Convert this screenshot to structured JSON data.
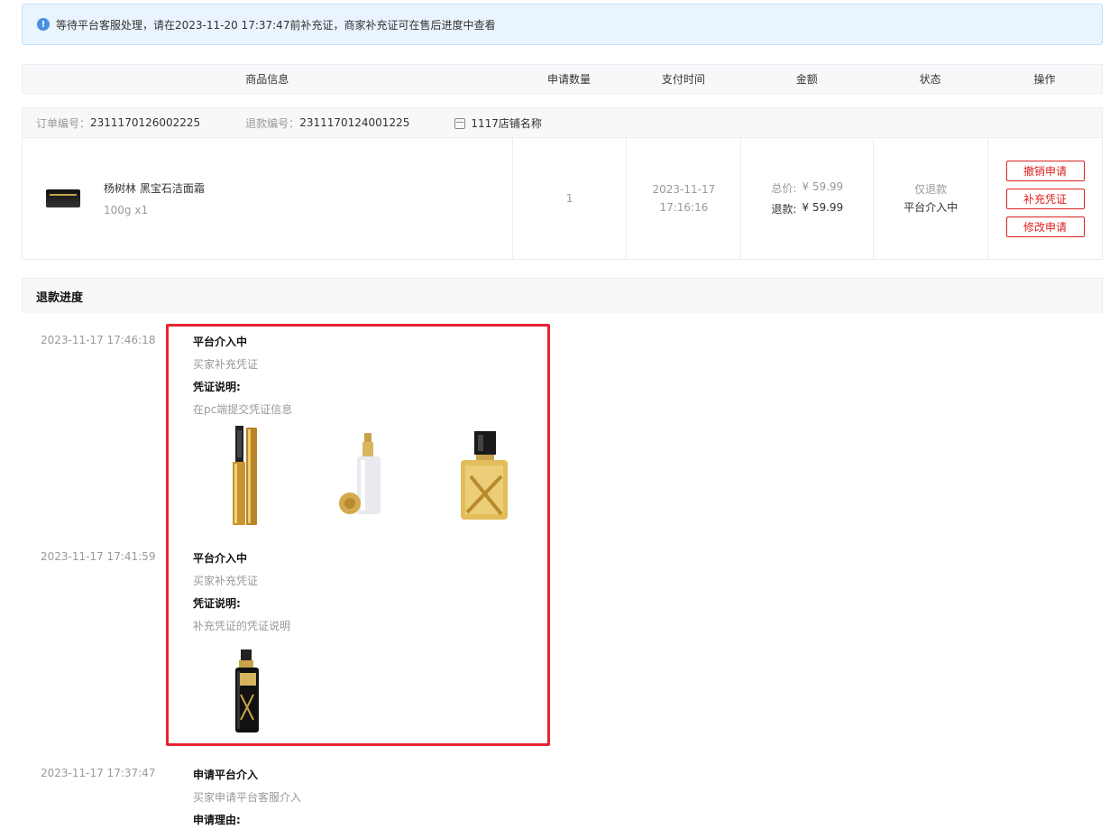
{
  "notice": {
    "icon": "info-icon",
    "text": "等待平台客服处理，请在2023-11-20 17:37:47前补充证，商家补充证可在售后进度中查看"
  },
  "table_header": [
    "商品信息",
    "申请数量",
    "支付时间",
    "金额",
    "状态",
    "操作"
  ],
  "order": {
    "order_no_label": "订单编号：",
    "order_no": "2311170126002225",
    "refund_no_label": "退款编号：",
    "refund_no": "2311170124001225",
    "store_icon": "store-icon",
    "store_name": "1117店铺名称",
    "product": {
      "name": "杨树林 黑宝石洁面霜",
      "spec": "100g x1"
    },
    "quantity": "1",
    "pay_date": "2023-11-17",
    "pay_time": "17:16:16",
    "total_label": "总价:",
    "total": "¥ 59.99",
    "refund_label": "退款:",
    "refund": "¥ 59.99",
    "status_type": "仅退款",
    "status": "平台介入中",
    "actions": [
      "撤销申请",
      "补充凭证",
      "修改申请"
    ]
  },
  "progress": {
    "title": "退款进度",
    "entries": [
      {
        "time": "2023-11-17 17:46:18",
        "title": "平台介入中",
        "desc": "买家补充凭证",
        "label": "凭证说明:",
        "detail": "在pc端提交凭证信息",
        "images": [
          "mascara-image",
          "foundation-bottle-image",
          "gold-perfume-image"
        ]
      },
      {
        "time": "2023-11-17 17:41:59",
        "title": "平台介入中",
        "desc": "买家补充凭证",
        "label": "凭证说明:",
        "detail": "补充凭证的凭证说明",
        "images": [
          "setting-spray-image"
        ]
      },
      {
        "time": "2023-11-17 17:37:47",
        "title": "申请平台介入",
        "desc": "买家申请平台客服介入",
        "label": "申请理由:"
      }
    ]
  },
  "colors": {
    "accent_red": "#e02020",
    "highlight_red": "#e8232f",
    "notice_bg": "#eaf4fe",
    "info_blue": "#4a90e2"
  }
}
